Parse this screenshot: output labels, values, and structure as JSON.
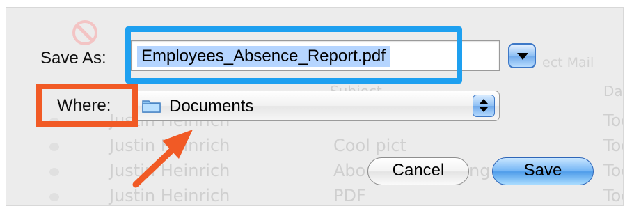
{
  "dialog": {
    "save_as_label": "Save As:",
    "filename": "Employees_Absence_Report.pdf",
    "where_label": "Where:",
    "where_value": "Documents",
    "cancel_label": "Cancel",
    "save_label": "Save"
  },
  "background": {
    "header_mail": "ect Mail",
    "subject_header": "Subject",
    "date_header": "Dat",
    "rows": [
      {
        "from": "Justin Heinrich",
        "subject": "",
        "date": "Too"
      },
      {
        "from": "Justin Heinrich",
        "subject": "Cool pict",
        "date": "Too"
      },
      {
        "from": "Justin Heinrich",
        "subject": "About the morning",
        "date": "Too"
      },
      {
        "from": "Justin Heinrich",
        "subject": "PDF",
        "date": "Too"
      }
    ]
  },
  "colors": {
    "highlight_blue": "#1ea0f0",
    "highlight_orange": "#f15a25",
    "selection": "#b5d5ff",
    "aqua_button": "#4d9be9"
  },
  "icons": [
    "folder-icon",
    "expand-icon",
    "stepper-icon",
    "arrow-annotation"
  ]
}
